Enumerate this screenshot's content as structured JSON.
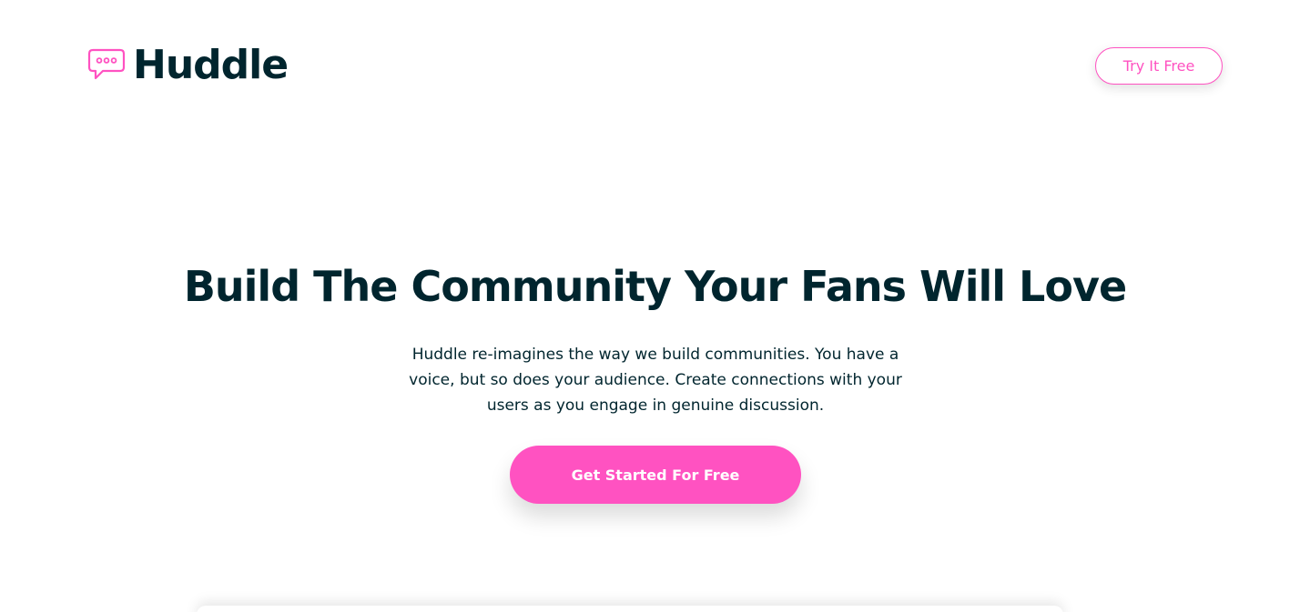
{
  "header": {
    "logo_text": "Huddle",
    "logo_icon": "chat-bubble-icon",
    "cta_label": "Try It Free"
  },
  "hero": {
    "title": "Build The Community Your Fans Will Love",
    "description": "Huddle re-imagines the way we build communities. You have a voice, but so does your audience. Create connections with your users as you engage in genuine discussion.",
    "cta_label": "Get Started For Free"
  },
  "colors": {
    "accent": "#ff52c1",
    "text_dark": "#00252e",
    "background": "#ffffff"
  }
}
